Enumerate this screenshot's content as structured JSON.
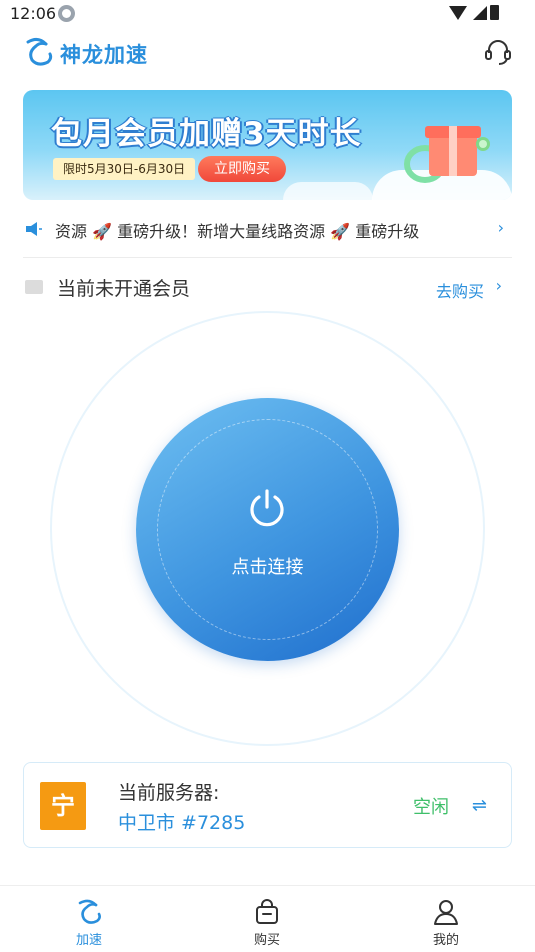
{
  "status_bar": {
    "time": "12:06"
  },
  "header": {
    "title": "神龙加速"
  },
  "banner": {
    "headline": "包月会员加赠3天时长",
    "date_range": "限时5月30日-6月30日",
    "cta_label": "立即购买"
  },
  "ticker": {
    "text": "资源   🚀 重磅升级！新增大量线路资源   🚀 重磅升级"
  },
  "membership": {
    "status_text": "当前未开通会员",
    "buy_label": "去购买"
  },
  "connect": {
    "label": "点击连接"
  },
  "server": {
    "badge": "宁",
    "label": "当前服务器:",
    "name": "中卫市 #7285",
    "status": "空闲"
  },
  "nav": {
    "items": [
      {
        "label": "加速"
      },
      {
        "label": "购买"
      },
      {
        "label": "我的"
      }
    ]
  },
  "colors": {
    "accent": "#2a8fdc",
    "status_idle": "#3fbf6a",
    "badge": "#f59a12"
  },
  "icons": [
    "wifi-icon",
    "signal-icon",
    "battery-icon",
    "logo-icon",
    "headset-icon",
    "speaker-icon",
    "rocket-icon",
    "membership-icon",
    "power-icon",
    "switch-icon",
    "accelerate-icon",
    "shopping-bag-icon",
    "user-icon"
  ]
}
